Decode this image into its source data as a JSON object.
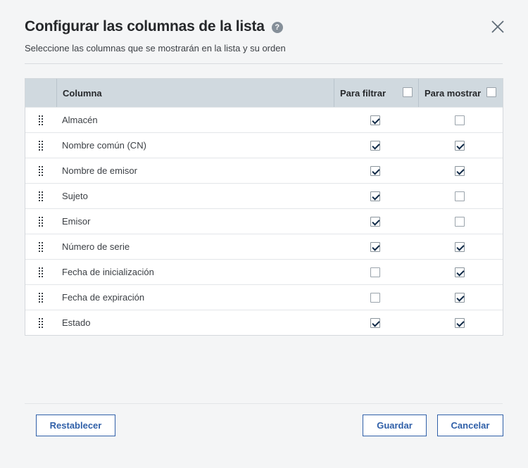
{
  "dialog": {
    "title": "Configurar las columnas de la lista",
    "subtitle": "Seleccione las columnas que se mostrarán en la lista y su orden",
    "help_icon": "?"
  },
  "grid": {
    "headers": {
      "column": "Columna",
      "filter": "Para filtrar",
      "show": "Para mostrar"
    },
    "header_filter_checked": false,
    "header_show_checked": false,
    "rows": [
      {
        "label": "Almacén",
        "filter": true,
        "show": false
      },
      {
        "label": "Nombre común (CN)",
        "filter": true,
        "show": true
      },
      {
        "label": "Nombre de emisor",
        "filter": true,
        "show": true
      },
      {
        "label": "Sujeto",
        "filter": true,
        "show": false
      },
      {
        "label": "Emisor",
        "filter": true,
        "show": false
      },
      {
        "label": "Número de serie",
        "filter": true,
        "show": true
      },
      {
        "label": "Fecha de inicialización",
        "filter": false,
        "show": true
      },
      {
        "label": "Fecha de expiración",
        "filter": false,
        "show": true
      },
      {
        "label": "Estado",
        "filter": true,
        "show": true
      }
    ]
  },
  "buttons": {
    "reset": "Restablecer",
    "save": "Guardar",
    "cancel": "Cancelar"
  },
  "icons": {
    "close": "close-icon",
    "help": "help-icon",
    "drag": "drag-handle-icon",
    "check": "checkmark-icon"
  },
  "colors": {
    "accent": "#2f5fa8",
    "header_bg": "#d0d9df",
    "check": "#0f2a47",
    "help_bg": "#858f99"
  }
}
